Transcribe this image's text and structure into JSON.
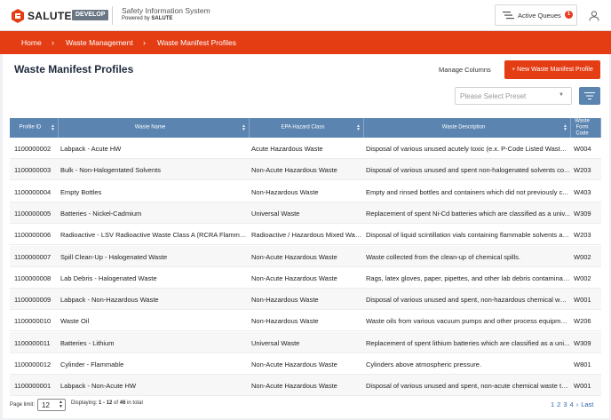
{
  "header": {
    "logo_text": "SALUTE",
    "env_badge": "DEVELOP",
    "system_title": "Safety Information System",
    "powered_by": "Powered by",
    "powered_brand": "SALUTE",
    "queues_label": "Active Queues",
    "queues_count": "1"
  },
  "breadcrumb": [
    "Home",
    "Waste Management",
    "Waste Manifest Profiles"
  ],
  "page": {
    "title": "Waste Manifest Profiles",
    "manage_columns": "Manage Columns",
    "new_button": "+ New Waste Manifest Profile",
    "preset_placeholder": "Please Select Preset"
  },
  "table": {
    "columns": [
      {
        "label": "Profile ID"
      },
      {
        "label": "Waste Name"
      },
      {
        "label": "EPA Hazard Class"
      },
      {
        "label": "Waste Description"
      },
      {
        "label": "Waste Form Code"
      }
    ],
    "rows": [
      [
        "1100000002",
        "Labpack - Acute HW",
        "Acute Hazardous Waste",
        "Disposal of various unused acutely toxic (e.x. P-Code Listed Waste) c...",
        "W004"
      ],
      [
        "1100000003",
        "Bulk - Non-Halogentated Solvents",
        "Non-Acute Hazardous Waste",
        "Disposal of various unused and spent non-halogenated solvents co...",
        "W203"
      ],
      [
        "1100000004",
        "Empty Bottles",
        "Non-Hazardous Waste",
        "Empty and rinsed bottles and containers which did not previously c...",
        "W403"
      ],
      [
        "1100000005",
        "Batteries - Nickel-Cadmium",
        "Universal Waste",
        "Replacement of spent Ni-Cd batteries which are classified as a univ...",
        "W309"
      ],
      [
        "1100000006",
        "Radioactive - LSV Radioactive Waste Class A (RCRA Flammable)",
        "Radioactive / Hazardous Mixed Waste",
        "Disposal of liquid scintillation vials containing flammable solvents an...",
        "W203"
      ],
      [
        "1100000007",
        "Spill Clean-Up - Halogenated Waste",
        "Non-Acute Hazardous Waste",
        "Waste collected from the clean-up of chemical spills.",
        "W002"
      ],
      [
        "1100000008",
        "Lab Debris - Halogenated Waste",
        "Non-Acute Hazardous Waste",
        "Rags, latex gloves, paper, pipettes, and other lab debris contaminat...",
        "W002"
      ],
      [
        "1100000009",
        "Labpack - Non-Hazardous Waste",
        "Non-Hazardous Waste",
        "Disposal of various unused and spent, non-hazardous chemical was...",
        "W001"
      ],
      [
        "1100000010",
        "Waste Oil",
        "Non-Hazardous Waste",
        "Waste oils from various vacuum pumps and other process equipment.",
        "W206"
      ],
      [
        "1100000011",
        "Batteries - Lithium",
        "Universal Waste",
        "Replacement of spent lithium batteries which are classified as a uni...",
        "W309"
      ],
      [
        "1100000012",
        "Cylinder - Flammable",
        "Non-Acute Hazardous Waste",
        "Cylinders above atmospheric pressure.",
        "W801"
      ],
      [
        "1100000001",
        "Labpack - Non-Acute HW",
        "Non-Acute Hazardous Waste",
        "Disposal of various unused and spent, non-acute chemical waste to...",
        "W001"
      ]
    ]
  },
  "footer": {
    "page_limit_label": "Page limit:",
    "page_limit_value": "12",
    "displaying_prefix": "Displaying:",
    "displaying_range": "1 - 12",
    "displaying_of": "of",
    "displaying_total": "46",
    "displaying_suffix": "in total",
    "pages": [
      "1",
      "2",
      "3",
      "4"
    ],
    "next": "›",
    "last": "Last"
  },
  "colors": {
    "accent": "#e43d14",
    "table_header": "#5b84b1",
    "link": "#2f66b3",
    "badge": "#e83b1f"
  }
}
